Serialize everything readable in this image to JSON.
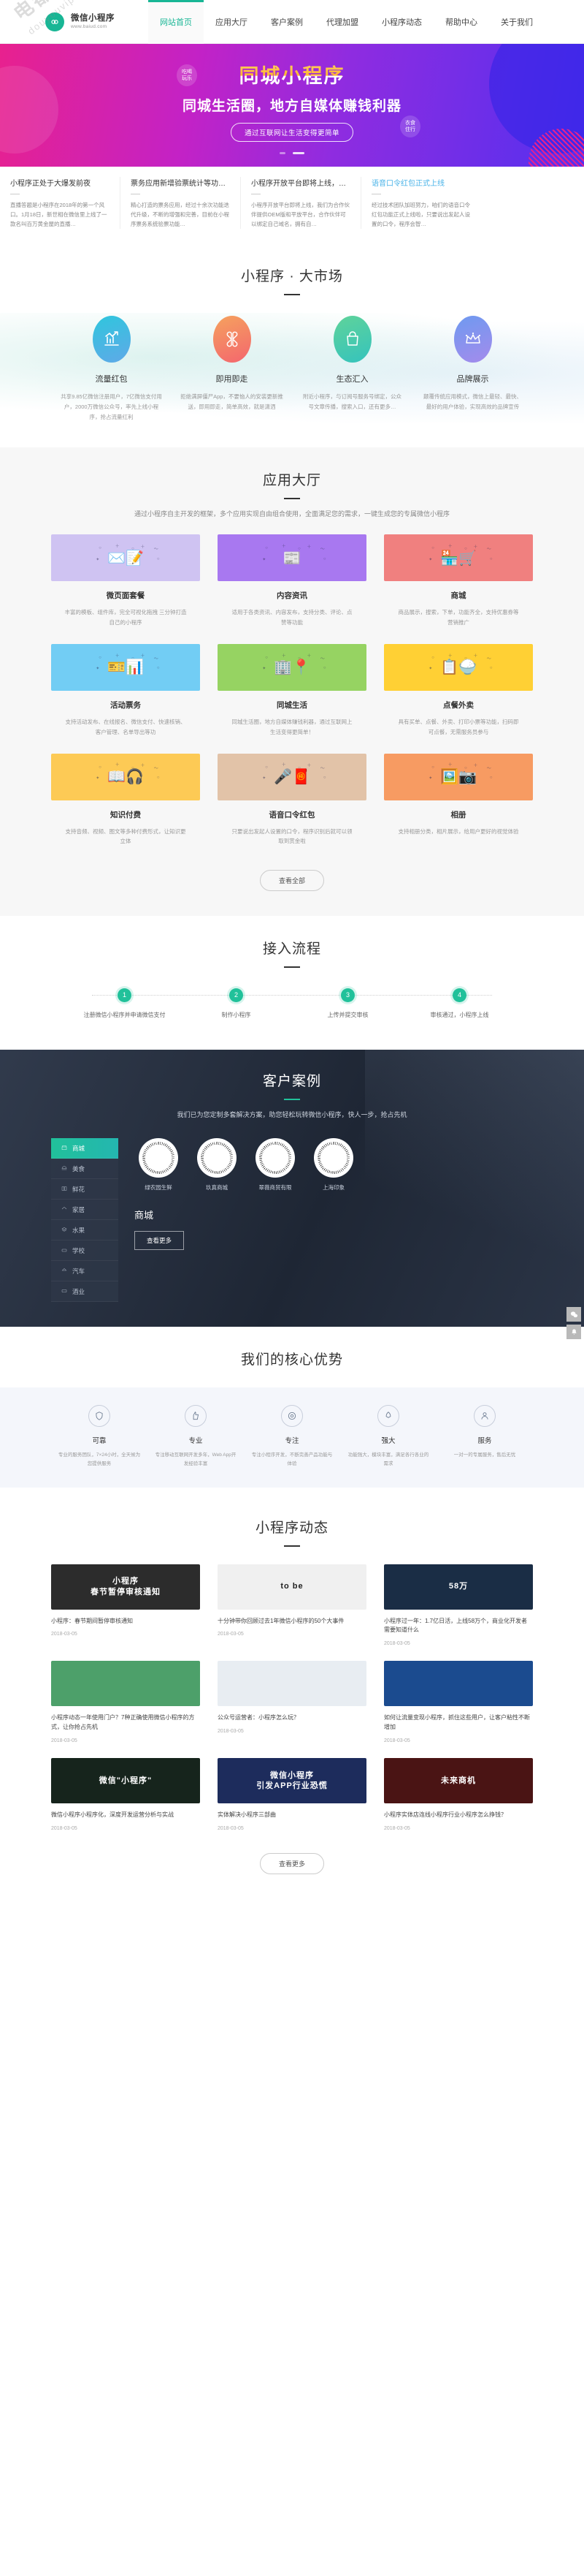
{
  "site": {
    "logo_title": "微信小程序",
    "logo_sub": "www.baiud.com",
    "logo_icon": "link-circle-icon",
    "watermark_line1": "电都有综合",
    "watermark_line2": "douyouvip.com"
  },
  "nav": {
    "items": [
      {
        "label": "网站首页",
        "active": true
      },
      {
        "label": "应用大厅",
        "active": false
      },
      {
        "label": "客户案例",
        "active": false
      },
      {
        "label": "代理加盟",
        "active": false
      },
      {
        "label": "小程序动态",
        "active": false
      },
      {
        "label": "帮助中心",
        "active": false
      },
      {
        "label": "关于我们",
        "active": false
      }
    ]
  },
  "hero": {
    "title": "同城小程序",
    "subtitle": "同城生活圈，地方自媒体赚钱利器",
    "button": "通过互联网让生活变得更简单",
    "bubble1": "吃喝\n玩乐",
    "bubble2": "衣食\n住行",
    "bubble1_l1": "吃喝",
    "bubble1_l2": "玩乐",
    "bubble2_l1": "衣食",
    "bubble2_l2": "住行"
  },
  "news_strip": [
    {
      "title": "小程序正处于大爆发前夜",
      "desc": "直播答题是小程序在2018年的第一个风口。1月18日，新世相在微信里上线了一款名叫百万黄金屋的直播…"
    },
    {
      "title": "票务应用新增验票统计等功…",
      "desc": "精心打造的票务应用，经过十余次功能迭代升级，不断的增强和完善，目前在小程序票务系统验票功能…"
    },
    {
      "title": "小程序开放平台即将上线，…",
      "desc": "小程序开放平台即将上线，我们为合作伙伴提供OEM版和平放平台，合作伙伴可以绑定自己域名，拥有自…"
    },
    {
      "title": "语音口令红包正式上线",
      "highlight": true,
      "desc": "经过技术团队加班努力，咱们的语音口令红包功能正式上线啦，只要说出发起人设置的口令，程序会智…"
    }
  ],
  "market": {
    "title": "小程序 · 大市场",
    "items": [
      {
        "icon": "chart-growth-icon",
        "color_a": "#2fc6dd",
        "color_b": "#5fa9e8",
        "title": "流量红包",
        "desc": "共享9.85亿微信注册用户，7亿微信支付用户，2000万微信公众号，率先上线小程序，抢占流量红利"
      },
      {
        "icon": "clover-icon",
        "color_a": "#f5a25e",
        "color_b": "#f4666e",
        "title": "即用即走",
        "desc": "拒绝满屏僵尸App，不要恼人的安装更新推送，即用即走，简单高效，就是潇洒"
      },
      {
        "icon": "shopping-bag-icon",
        "color_a": "#5fd39a",
        "color_b": "#35c3bd",
        "title": "生态汇入",
        "desc": "附近小程序，与订阅号服务号绑定，公众号文章传播，搜索入口，还有更多…"
      },
      {
        "icon": "crown-icon",
        "color_a": "#6e9af0",
        "color_b": "#a48bec",
        "title": "品牌展示",
        "desc": "颠覆传统应用模式，微信上最轻、最快、最好的用户体验，实现高效的品牌宣传"
      }
    ]
  },
  "hall": {
    "title": "应用大厅",
    "desc": "通过小程序自主开发的框架，多个应用实现自由组合使用，全面满足您的需求，一键生成您的专属微信小程序",
    "view_all": "查看全部",
    "cards": [
      {
        "title": "微页面套餐",
        "desc": "丰富的模板、组件库，完全可视化拖拽 三分钟打造自己的小程序",
        "bg": "#cfc3f2",
        "icon": "envelope-pencil-icon"
      },
      {
        "title": "内容资讯",
        "desc": "适用于各类资讯、内容发布，支持分类、评论、点赞等功能",
        "bg": "#a878f0",
        "icon": "newspaper-icon"
      },
      {
        "title": "商城",
        "desc": "商品展示，搜索，下单，功能齐全，支持优惠券等营销推广",
        "bg": "#f0807f",
        "icon": "shop-cart-icon"
      },
      {
        "title": "活动票务",
        "desc": "支持活动发布、在线报名、微信支付、快速核销、客户管理、名单导出等功",
        "bg": "#72cdf4",
        "icon": "ticket-chart-icon"
      },
      {
        "title": "同城生活",
        "desc": "同城生活圈，地方自媒体赚钱利器，通过互联网上生活变得更简单！",
        "bg": "#96d362",
        "icon": "city-pin-icon"
      },
      {
        "title": "点餐外卖",
        "desc": "具有买单、点餐、外卖、打印小票等功能，扫码即可点餐，无需服务员参与",
        "bg": "#ffd034",
        "icon": "menu-bowl-icon"
      },
      {
        "title": "知识付费",
        "desc": "支持音频、视频、图文等多种付费形式，让知识更立体",
        "bg": "#fdca55",
        "icon": "book-audio-icon"
      },
      {
        "title": "语音口令红包",
        "desc": "只要说出发起人设置的口令，程序识别后就可以领取到赏金啦",
        "bg": "#e2c3a8",
        "icon": "mic-red-packet-icon"
      },
      {
        "title": "相册",
        "desc": "支持相册分类，相片展示，给用户更好的视觉体验",
        "bg": "#f79b62",
        "icon": "photo-camera-icon"
      }
    ]
  },
  "process": {
    "title": "接入流程",
    "steps": [
      {
        "num": "1",
        "label": "注册微信小程序并申请微信支付"
      },
      {
        "num": "2",
        "label": "制作小程序"
      },
      {
        "num": "3",
        "label": "上传并提交审核"
      },
      {
        "num": "4",
        "label": "审核通过，小程序上线"
      }
    ]
  },
  "cases": {
    "title": "客户案例",
    "desc": "我们已为您定制多套解决方案，助您轻松玩转微信小程序，快人一步，抢占先机",
    "sidebar": [
      {
        "label": "商城",
        "icon": "shop-icon",
        "active": true
      },
      {
        "label": "美食",
        "icon": "food-icon",
        "active": false
      },
      {
        "label": "鲜花",
        "icon": "flower-icon",
        "active": false
      },
      {
        "label": "家居",
        "icon": "home-icon",
        "active": false
      },
      {
        "label": "水果",
        "icon": "fruit-icon",
        "active": false
      },
      {
        "label": "学校",
        "icon": "school-icon",
        "active": false
      },
      {
        "label": "汽车",
        "icon": "car-icon",
        "active": false
      },
      {
        "label": "酒业",
        "icon": "wine-icon",
        "active": false
      }
    ],
    "logos": [
      {
        "name": "绿农园生鲜"
      },
      {
        "name": "玖真商城"
      },
      {
        "name": "翠薇商贸有限"
      },
      {
        "name": "上海印象"
      }
    ],
    "category": "商城",
    "more_button": "查看更多"
  },
  "advantage": {
    "title": "我们的核心优势",
    "items": [
      {
        "icon": "shield-icon",
        "title": "可靠",
        "desc": "专业的服务团队，7×24小时，全天候为您提供服务"
      },
      {
        "icon": "thumbs-up-icon",
        "title": "专业",
        "desc": "专注移动互联网开发多年，Web App开发经验丰富"
      },
      {
        "icon": "target-icon",
        "title": "专注",
        "desc": "专注小程序开发，不断完善产品功能与体验"
      },
      {
        "icon": "rocket-icon",
        "title": "强大",
        "desc": "功能强大，模块丰富，满足各行各业的需求"
      },
      {
        "icon": "user-icon",
        "title": "服务",
        "desc": "一对一的专属服务，售后无忧"
      }
    ]
  },
  "news": {
    "title": "小程序动态",
    "view_all": "查看更多",
    "items": [
      {
        "thumb_text": "小程序\n春节暂停审核通知",
        "thumb_bg": "#2c2c2c",
        "title": "小程序：春节期间暂停审核通知",
        "date": "2018-03-05"
      },
      {
        "thumb_text": "to be",
        "thumb_bg": "#f0f0f0",
        "title": "十分钟带你回顾过去1年微信小程序的50个大事件",
        "date": "2018-03-05"
      },
      {
        "thumb_text": "58万",
        "thumb_bg": "#1a2d45",
        "title": "小程序过一年：1.7亿日活，上线58万个，商业化开发者需要知道什么",
        "date": "2018-03-05"
      },
      {
        "thumb_text": "",
        "thumb_bg": "#4da06a",
        "title": "小程序动态一年使用门户？7种正确使用微信小程序的方式，让你抢占先机",
        "date": "2018-03-05"
      },
      {
        "thumb_text": "",
        "thumb_bg": "#e8edf2",
        "title": "公众号运营者：小程序怎么玩？",
        "date": "2018-03-05"
      },
      {
        "thumb_text": "",
        "thumb_bg": "#1b4b8f",
        "title": "如何让流量变现小程序，抓住这些用户，让客户粘性不断增加",
        "date": "2018-03-05"
      },
      {
        "thumb_text": "微信\"小程序\"",
        "thumb_bg": "#16241c",
        "title": "微信小程序小程序化，深度开发运营分析与实战",
        "date": "2018-03-05"
      },
      {
        "thumb_text": "微信小程序\n引发APP行业恐慌",
        "thumb_bg": "#1d2c5c",
        "title": "实体解决小程序三部曲",
        "date": "2018-03-05"
      },
      {
        "thumb_text": "未来商机",
        "thumb_bg": "#4a1414",
        "title": "小程序实体店连线小程序行业小程序怎么挣钱？",
        "date": "2018-03-05"
      }
    ]
  },
  "rail": [
    {
      "icon": "wechat-icon"
    },
    {
      "icon": "bell-icon"
    }
  ]
}
